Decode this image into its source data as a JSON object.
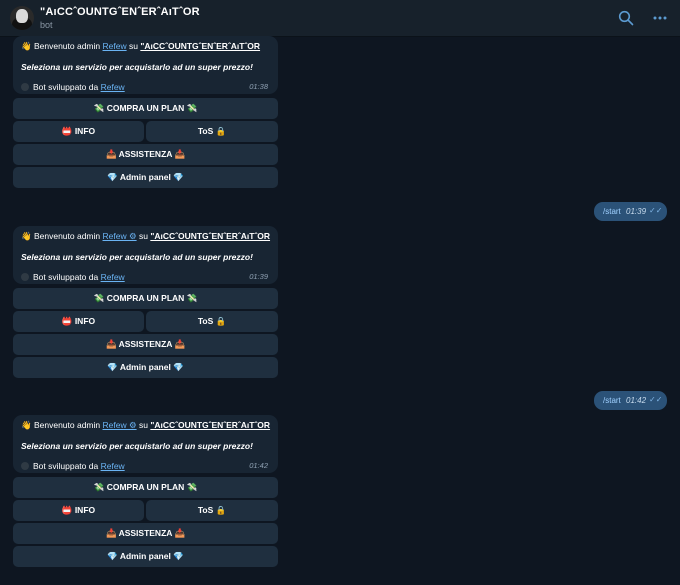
{
  "header": {
    "title": "\"AıCCˆOUNTGˆENˆERˆAıTˆOR",
    "subtitle": "bot",
    "search_icon": "search-icon",
    "menu_icon": "more-icon"
  },
  "bot_messages": [
    {
      "wave": "👋",
      "text_a": "Benvenuto admin",
      "link": "Refew",
      "text_b": "su",
      "bot_name": "\"AıCCˆOUNTGˆENˆERˆAıTˆOR",
      "subtitle": "Seleziona un servizio per acquistarlo ad un super prezzo!",
      "dev_text": "Bot sviluppato da",
      "dev_link": "Refew",
      "time": "01:38"
    },
    {
      "wave": "👋",
      "text_a": "Benvenuto admin",
      "link": "Refew ⚙",
      "text_b": "su",
      "bot_name": "\"AıCCˆOUNTGˆENˆERˆAıTˆOR",
      "subtitle": "Seleziona un servizio per acquistarlo ad un super prezzo!",
      "dev_text": "Bot sviluppato da",
      "dev_link": "Refew",
      "time": "01:39"
    },
    {
      "wave": "👋",
      "text_a": "Benvenuto admin",
      "link": "Refew ⚙",
      "text_b": "su",
      "bot_name": "\"AıCCˆOUNTGˆENˆERˆAıTˆOR",
      "subtitle": "Seleziona un servizio per acquistarlo ad un super prezzo!",
      "dev_text": "Bot sviluppato da",
      "dev_link": "Refew",
      "time": "01:42"
    }
  ],
  "keyboard": {
    "compra": "💸 COMPRA UN PLAN 💸",
    "info": "📛 INFO",
    "tos": "ToS 🔒",
    "assistenza": "📥 ASSISTENZA 📥",
    "admin": "💎 Admin panel 💎"
  },
  "outgoing": [
    {
      "text": "/start",
      "time": "01:39",
      "ticks": "✓✓"
    },
    {
      "text": "/start",
      "time": "01:42",
      "ticks": "✓✓"
    }
  ],
  "colors": {
    "background": "#0e1621",
    "bubble": "#182533",
    "outgoing_bubble": "#2b5278",
    "link": "#6ab3f3"
  }
}
